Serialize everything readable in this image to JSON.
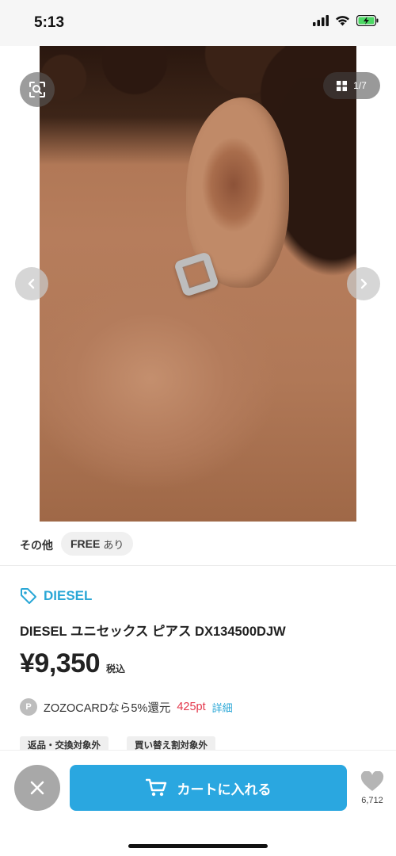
{
  "status_bar": {
    "time": "5:13"
  },
  "gallery": {
    "page_current": "1",
    "page_total": "7",
    "page_separator": "/"
  },
  "size": {
    "label": "その他",
    "value": "FREE",
    "availability": "あり"
  },
  "product": {
    "brand": "DIESEL",
    "title": "DIESEL ユニセックス ピアス DX134500DJW",
    "price": "¥9,350",
    "tax_note": "税込"
  },
  "points": {
    "badge": "P",
    "text": "ZOZOCARDなら5%還元",
    "amount": "425pt",
    "link": "詳細"
  },
  "tags": [
    "返品・交換対象外",
    "買い替え割対象外"
  ],
  "actions": {
    "cart_label": "カートに入れる",
    "favorite_count": "6,712"
  },
  "colors": {
    "accent": "#2aa7e0",
    "points_red": "#e3374b",
    "brand_blue": "#2aa7d6"
  },
  "icons": [
    "signal-icon",
    "wifi-icon",
    "battery-charging-icon",
    "image-search-icon",
    "grid-icon",
    "chevron-left-icon",
    "chevron-right-icon",
    "tag-icon",
    "close-icon",
    "cart-icon",
    "heart-icon"
  ]
}
